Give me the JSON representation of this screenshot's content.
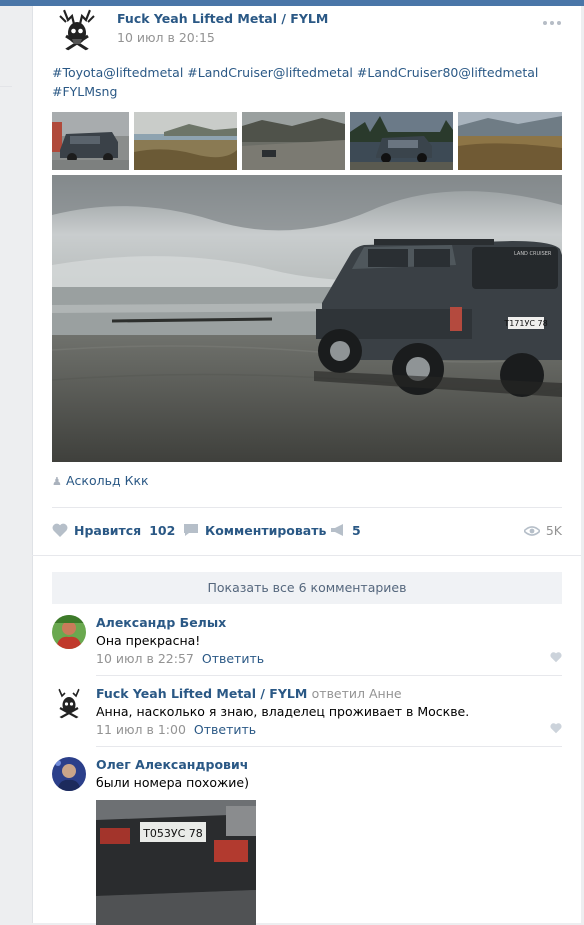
{
  "post": {
    "author": "Fuck Yeah Lifted Metal / FYLM",
    "date": "10 июл в 20:15",
    "tags": [
      "#Toyota@liftedmetal",
      "#LandCruiser@liftedmetal",
      "#LandCruiser80@liftedmetal",
      "#FYLMsng"
    ],
    "signer": "Аскольд Ккк",
    "plate": "Т171УС 78",
    "brand": "LAND CRUISER"
  },
  "actions": {
    "like_label": "Нравится",
    "like_count": "102",
    "comment_label": "Комментировать",
    "share_count": "5",
    "views": "5K"
  },
  "comments_block": {
    "show_all": "Показать все 6 комментариев",
    "items": [
      {
        "author": "Александр Белых",
        "replied_to": "",
        "text": "Она прекрасна!",
        "date": "10 июл в 22:57",
        "reply_label": "Ответить"
      },
      {
        "author": "Fuck Yeah Lifted Metal / FYLM",
        "replied_to": "ответил Анне",
        "text": "Анна, насколько я знаю, владелец проживает в Москве.",
        "date": "11 июл в 1:00",
        "reply_label": "Ответить"
      },
      {
        "author": "Олег Александрович",
        "replied_to": "",
        "text": "были номера похожие)",
        "photo_plate": "Т053УС 78"
      }
    ]
  },
  "colors": {
    "link": "#2a5885",
    "accent": "#4a76a8",
    "muted": "#939393"
  }
}
